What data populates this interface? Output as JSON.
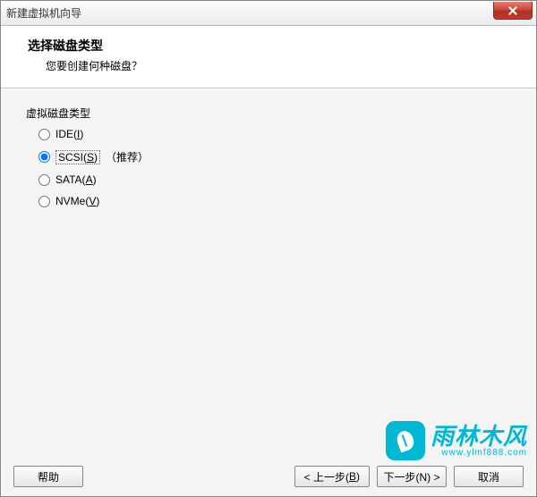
{
  "titlebar": {
    "title": "新建虚拟机向导"
  },
  "header": {
    "title": "选择磁盘类型",
    "subtitle": "您要创建何种磁盘？"
  },
  "section": {
    "label": "虚拟磁盘类型"
  },
  "options": {
    "ide": {
      "prefix": "IDE(",
      "key": "I",
      "suffix": ")"
    },
    "scsi": {
      "prefix": "SCSI(",
      "key": "S",
      "suffix": ")",
      "recommend": "（推荐）"
    },
    "sata": {
      "prefix": "SATA(",
      "key": "A",
      "suffix": ")"
    },
    "nvme": {
      "prefix": "NVMe(",
      "key": "V",
      "suffix": ")"
    }
  },
  "footer": {
    "help": "帮助",
    "back_prefix": "< 上一步(",
    "back_key": "B",
    "back_suffix": ")",
    "next": "下一步(N) >",
    "cancel": "取消"
  },
  "watermark": {
    "text": "雨林木风",
    "url": "www.ylmf888.com"
  }
}
